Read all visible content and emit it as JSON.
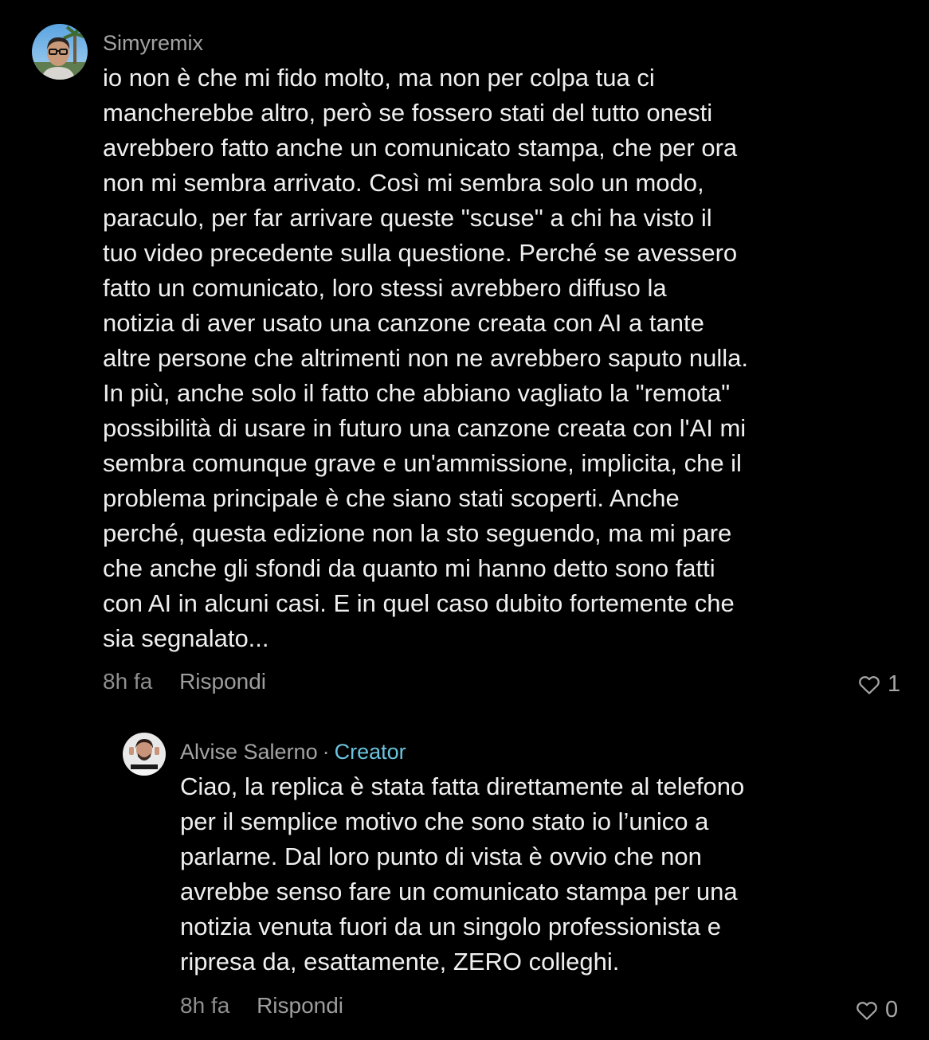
{
  "comments": [
    {
      "author": "Simyremix",
      "avatar_icon": "user-avatar-glasses",
      "lines": [
        "io non è che mi fido molto, ma non per colpa tua ci",
        "mancherebbe altro, però se fossero stati del tutto onesti",
        "avrebbero fatto anche un comunicato stampa, che per ora",
        "non mi sembra arrivato. Così mi sembra solo un modo,",
        "paraculo, per far arrivare queste \"scuse\" a chi ha visto il",
        "tuo video precedente sulla questione. Perché se avessero",
        "fatto un comunicato, loro stessi avrebbero diffuso la",
        "notizia di aver usato una canzone creata con AI a tante",
        "altre persone che altrimenti non ne avrebbero saputo nulla.",
        "In più, anche solo il fatto che abbiano vagliato la \"remota\"",
        "possibilità di usare in futuro una canzone creata con l'AI mi",
        "sembra comunque grave e un'ammissione, implicita, che il",
        "problema principale è che siano stati scoperti. Anche",
        "perché, questa edizione non la sto seguendo, ma mi pare",
        "che anche gli sfondi da quanto mi hanno detto sono fatti",
        "con AI in alcuni casi. E in quel caso dubito fortemente che",
        "sia segnalato..."
      ],
      "time": "8h fa",
      "reply_label": "Rispondi",
      "likes": "1",
      "like_icon": "heart-outline-icon"
    },
    {
      "author": "Alvise Salerno",
      "separator": "·",
      "badge": "Creator",
      "avatar_icon": "creator-avatar",
      "lines": [
        "Ciao, la replica è stata fatta direttamente al telefono",
        "per il semplice motivo che sono stato io l’unico a",
        "parlarne. Dal loro punto di vista è ovvio che non",
        "avrebbe senso fare un comunicato stampa per una",
        "notizia venuta fuori da un singolo professionista e",
        "ripresa da, esattamente, ZERO colleghi."
      ],
      "time": "8h fa",
      "reply_label": "Rispondi",
      "likes": "0",
      "like_icon": "heart-outline-icon"
    }
  ],
  "colors": {
    "background": "#000000",
    "text": "#efefef",
    "author": "#a3a3a3",
    "meta": "#8f8f8f",
    "creator_badge": "#6cc3dd"
  }
}
